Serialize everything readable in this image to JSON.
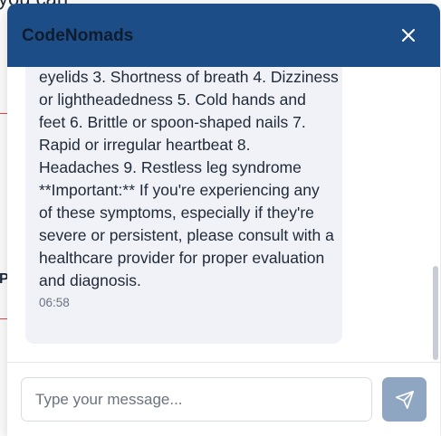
{
  "background": {
    "top_text": "you can",
    "side_letter": "P"
  },
  "header": {
    "title": "CodeNomads",
    "close_icon": "close-icon",
    "background_color": "#1d4d86"
  },
  "message": {
    "lines": [
      "eyelids 3. Shortness of breath 4. Dizziness",
      "or lightheadedness 5. Cold hands and",
      "feet 6. Brittle or spoon-shaped nails 7.",
      "Rapid or irregular heartbeat 8.",
      "Headaches 9. Restless leg syndrome",
      "**Important:** If you're experiencing any",
      "of these symptoms, especially if they're",
      "severe or persistent, please consult with a",
      "healthcare provider for proper evaluation",
      "and diagnosis."
    ],
    "time": "06:58"
  },
  "composer": {
    "placeholder": "Type your message...",
    "value": "",
    "send_icon": "send-icon",
    "send_color": "#8fa6c3"
  }
}
